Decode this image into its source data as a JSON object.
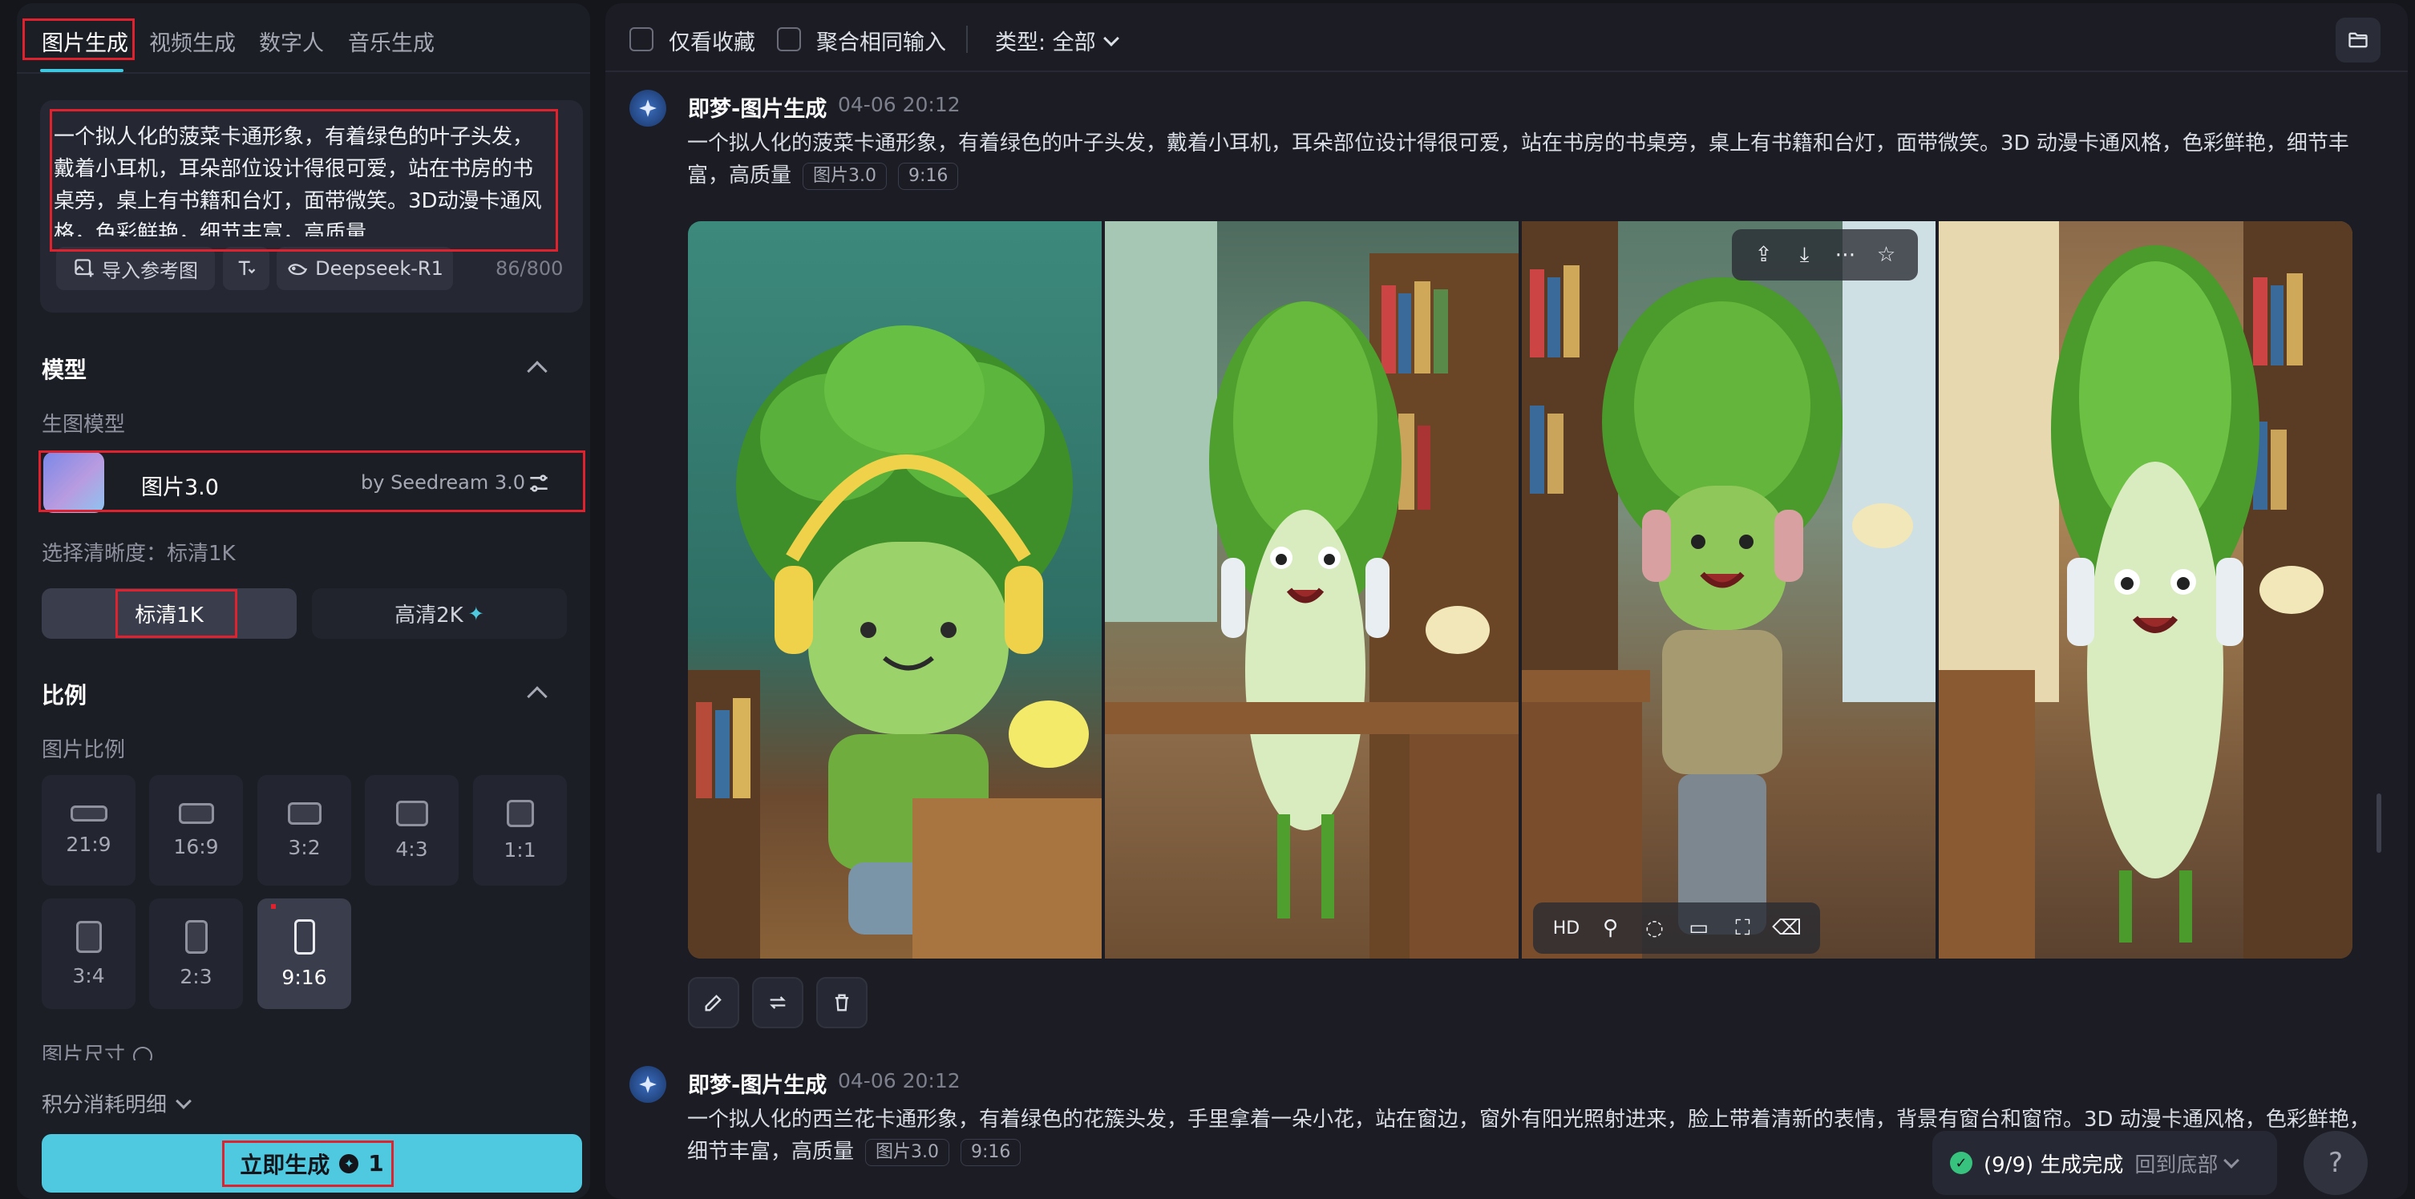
{
  "sidebar": {
    "tabs": [
      "图片生成",
      "视频生成",
      "数字人",
      "音乐生成"
    ],
    "prompt": "一个拟人化的菠菜卡通形象，有着绿色的叶子头发，戴着小耳机，耳朵部位设计得很可爱，站在书房的书桌旁，桌上有书籍和台灯，面带微笑。3D动漫卡通风格，色彩鲜艳，细节丰富，高质量",
    "import_ref_label": "导入参考图",
    "deepseek_label": "Deepseek-R1",
    "char_count": "86/800",
    "model_section": "模型",
    "model_sub": "生图模型",
    "model_name": "图片3.0",
    "model_by": "by Seedream 3.0",
    "resolution_label": "选择清晰度：标清1K",
    "res_options": [
      "标清1K",
      "高清2K"
    ],
    "ratio_section": "比例",
    "ratio_sub": "图片比例",
    "ratios": [
      "21:9",
      "16:9",
      "3:2",
      "4:3",
      "1:1",
      "3:4",
      "2:3",
      "9:16"
    ],
    "selected_ratio": "9:16",
    "size_label": "图片尺寸",
    "credits_label": "积分消耗明细",
    "generate_label": "立即生成",
    "generate_cost": "1"
  },
  "topbar": {
    "fav_only": "仅看收藏",
    "merge_same": "聚合相同输入",
    "type_filter": "类型: 全部"
  },
  "records": [
    {
      "title": "即梦-图片生成",
      "time": "04-06  20:12",
      "prompt": "一个拟人化的菠菜卡通形象，有着绿色的叶子头发，戴着小耳机，耳朵部位设计得很可爱，站在书房的书桌旁，桌上有书籍和台灯，面带微笑。3D 动漫卡通风格，色彩鲜艳，细节丰富，高质量",
      "tags": [
        "图片3.0",
        "9:16"
      ]
    },
    {
      "title": "即梦-图片生成",
      "time": "04-06  20:12",
      "prompt": "一个拟人化的西兰花卡通形象，有着绿色的花簇头发，手里拿着一朵小花，站在窗边，窗外有阳光照射进来，脸上带着清新的表情，背景有窗台和窗帘。3D 动漫卡通风格，色彩鲜艳，细节丰富，高质量",
      "tags": [
        "图片3.0",
        "9:16"
      ]
    }
  ],
  "image_overlay": {
    "hd_label": "HD"
  },
  "status": {
    "text": "(9/9) 生成完成",
    "back_bottom": "回到底部"
  },
  "colors": {
    "accent": "#4ec9df",
    "highlight_box": "#e0212e",
    "success": "#37c27d"
  }
}
